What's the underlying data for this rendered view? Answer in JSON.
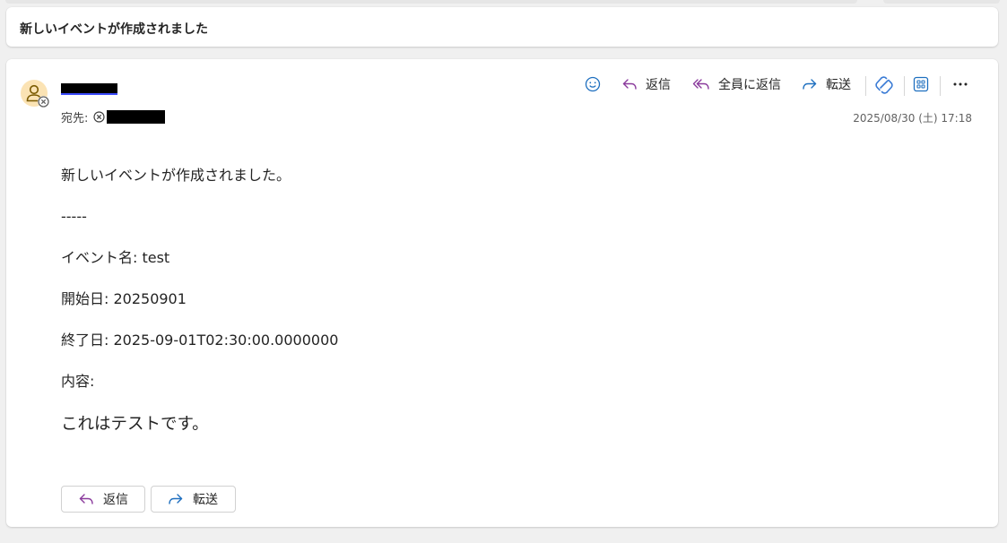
{
  "subject": "新しいイベントが作成されました",
  "header": {
    "to_label": "宛先:",
    "timestamp": "2025/08/30 (土) 17:18"
  },
  "toolbar": {
    "reply_label": "返信",
    "reply_all_label": "全員に返信",
    "forward_label": "転送"
  },
  "body": {
    "lines": [
      "新しいイベントが作成されました。",
      "-----",
      "イベント名: test",
      "開始日: 20250901",
      "終了日: 2025-09-01T02:30:00.0000000",
      "内容:",
      "これはテストです。"
    ]
  },
  "bottom_actions": {
    "reply_label": "返信",
    "forward_label": "転送"
  },
  "colors": {
    "reply_icon": "#8a3a9c",
    "forward_icon": "#1e6fbf",
    "avatar_bg": "#fbe3b4",
    "avatar_fg": "#7a5a00"
  }
}
